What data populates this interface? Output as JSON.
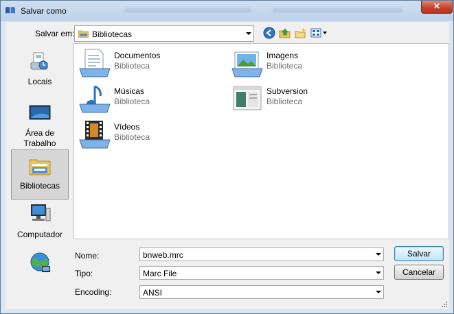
{
  "window": {
    "title": "Salvar como",
    "close_glyph": "✕"
  },
  "toolbar": {
    "save_in_label": "Salvar em:",
    "save_in_value": "Bibliotecas",
    "icons": [
      "back-icon",
      "up-folder-icon",
      "new-folder-icon",
      "view-menu-icon"
    ]
  },
  "places": [
    {
      "label": "Locais",
      "icon": "recent-places-icon",
      "selected": false
    },
    {
      "label": "Área de Trabalho",
      "icon": "desktop-icon",
      "selected": false
    },
    {
      "label": "Bibliotecas",
      "icon": "libraries-icon",
      "selected": true
    },
    {
      "label": "Computador",
      "icon": "computer-icon",
      "selected": false
    },
    {
      "label": "",
      "icon": "network-icon",
      "selected": false
    }
  ],
  "libraries": [
    {
      "name": "Documentos",
      "type": "Biblioteca",
      "icon": "documents-library-icon"
    },
    {
      "name": "Imagens",
      "type": "Biblioteca",
      "icon": "pictures-library-icon"
    },
    {
      "name": "Músicas",
      "type": "Biblioteca",
      "icon": "music-library-icon"
    },
    {
      "name": "Subversion",
      "type": "Biblioteca",
      "icon": "subversion-library-icon"
    },
    {
      "name": "Vídeos",
      "type": "Biblioteca",
      "icon": "videos-library-icon"
    }
  ],
  "form": {
    "name_label": "Nome:",
    "name_value": "bnweb.mrc",
    "type_label": "Tipo:",
    "type_value": "Marc File",
    "encoding_label": "Encoding:",
    "encoding_value": "ANSI"
  },
  "buttons": {
    "save": "Salvar",
    "cancel": "Cancelar"
  },
  "colors": {
    "title_bar": "#c4d7ee",
    "close_button": "#c7432f",
    "selection": "#d6d6d6",
    "secondary_text": "#6d6d6d"
  }
}
